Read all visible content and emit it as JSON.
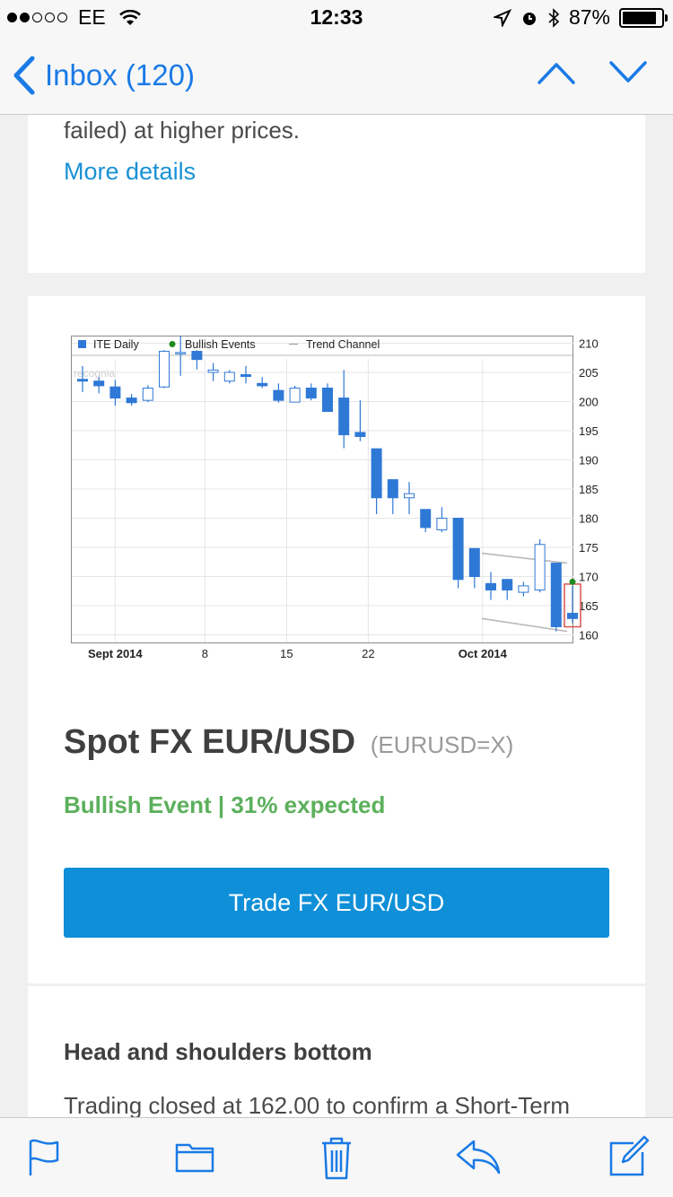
{
  "status": {
    "carrier": "EE",
    "time": "12:33",
    "battery": "87%",
    "battery_level": 0.87
  },
  "nav": {
    "back_label": "Inbox (120)"
  },
  "card1": {
    "partial_text": "sellers evens out and there's an attempt (though failed) at higher prices.",
    "more_link": "More details"
  },
  "chart_data": {
    "type": "candlestick",
    "title": "",
    "legend": [
      "ITE Daily",
      "Bullish Events",
      "Trend Channel"
    ],
    "watermark": "recognia",
    "x_tick_labels": [
      "Sept 2014",
      "8",
      "15",
      "22",
      "Oct 2014"
    ],
    "y_ticks": [
      210,
      205,
      200,
      195,
      190,
      185,
      180,
      175,
      170,
      165,
      160
    ],
    "ylim": [
      158.7,
      211.3
    ],
    "grid": true,
    "candles": [
      {
        "o": 203.8,
        "c": 203.5,
        "h": 206.1,
        "l": 201.6
      },
      {
        "o": 203.5,
        "c": 202.7,
        "h": 204.2,
        "l": 201.4
      },
      {
        "o": 202.5,
        "c": 200.6,
        "h": 203.7,
        "l": 199.3
      },
      {
        "o": 200.6,
        "c": 199.8,
        "h": 201.3,
        "l": 199.3
      },
      {
        "o": 200.2,
        "c": 202.3,
        "h": 202.8,
        "l": 199.9
      },
      {
        "o": 202.5,
        "c": 208.6,
        "h": 208.8,
        "l": 202.3
      },
      {
        "o": 208.2,
        "c": 208.4,
        "h": 211.3,
        "l": 204.4
      },
      {
        "o": 208.6,
        "c": 207.2,
        "h": 208.8,
        "l": 205.5
      },
      {
        "o": 205.0,
        "c": 205.4,
        "h": 206.6,
        "l": 203.5
      },
      {
        "o": 203.5,
        "c": 205.0,
        "h": 205.4,
        "l": 203.1
      },
      {
        "o": 204.6,
        "c": 204.3,
        "h": 206.1,
        "l": 203.1
      },
      {
        "o": 203.1,
        "c": 202.7,
        "h": 204.2,
        "l": 202.3
      },
      {
        "o": 201.9,
        "c": 200.2,
        "h": 203.1,
        "l": 199.8
      },
      {
        "o": 199.9,
        "c": 202.3,
        "h": 202.7,
        "l": 199.9
      },
      {
        "o": 202.3,
        "c": 200.6,
        "h": 203.1,
        "l": 200.2
      },
      {
        "o": 202.3,
        "c": 198.3,
        "h": 203.1,
        "l": 198.3
      },
      {
        "o": 200.6,
        "c": 194.3,
        "h": 205.4,
        "l": 192.0
      },
      {
        "o": 194.7,
        "c": 194.0,
        "h": 200.2,
        "l": 193.2
      },
      {
        "o": 191.9,
        "c": 183.5,
        "h": 191.9,
        "l": 180.7
      },
      {
        "o": 186.6,
        "c": 183.5,
        "h": 186.6,
        "l": 180.7
      },
      {
        "o": 183.5,
        "c": 184.2,
        "h": 186.2,
        "l": 180.7
      },
      {
        "o": 181.5,
        "c": 178.4,
        "h": 181.5,
        "l": 177.6
      },
      {
        "o": 178.0,
        "c": 180.0,
        "h": 181.9,
        "l": 177.6
      },
      {
        "o": 180.0,
        "c": 169.5,
        "h": 180.0,
        "l": 168.0
      },
      {
        "o": 174.8,
        "c": 170.0,
        "h": 174.8,
        "l": 168.0
      },
      {
        "o": 168.8,
        "c": 167.7,
        "h": 170.8,
        "l": 166.0
      },
      {
        "o": 169.5,
        "c": 167.7,
        "h": 169.6,
        "l": 166.0
      },
      {
        "o": 167.3,
        "c": 168.4,
        "h": 169.1,
        "l": 166.6
      },
      {
        "o": 167.7,
        "c": 175.5,
        "h": 176.4,
        "l": 167.3
      },
      {
        "o": 172.3,
        "c": 161.4,
        "h": 172.3,
        "l": 160.6
      },
      {
        "o": 163.7,
        "c": 162.8,
        "h": 168.4,
        "l": 162.0
      }
    ],
    "trend_channel": [
      {
        "from": [
          25.0,
          174.0
        ],
        "to": [
          30.0,
          172.3
        ]
      },
      {
        "from": [
          25.0,
          162.8
        ],
        "to": [
          30.0,
          160.6
        ]
      }
    ],
    "bullish_events": [
      {
        "x": 30,
        "y": 169.1
      }
    ],
    "highlight_candle": 30,
    "colors": {
      "down": "#2f79d6",
      "up_fill": "#ffffff",
      "wick": "#2f79d6",
      "event": "#1d8a1d",
      "highlight": "#d9534f",
      "channel": "#b8b8b8"
    }
  },
  "instrument": {
    "name": "Spot FX EUR/USD",
    "ticker": "(EURUSD=X)"
  },
  "event": "Bullish Event | 31% expected",
  "trade_button": "Trade FX EUR/USD",
  "card3": {
    "heading": "Head and shoulders bottom",
    "text": "Trading closed at 162.00 to confirm a Short-Term"
  },
  "toolbar": {
    "icons": [
      "flag-icon",
      "folder-icon",
      "trash-icon",
      "reply-icon",
      "compose-icon"
    ]
  },
  "colors": {
    "accent": "#1a7ae6",
    "link": "#1a91d6",
    "button": "#0e8fd8",
    "bullish": "#5cb05c"
  }
}
